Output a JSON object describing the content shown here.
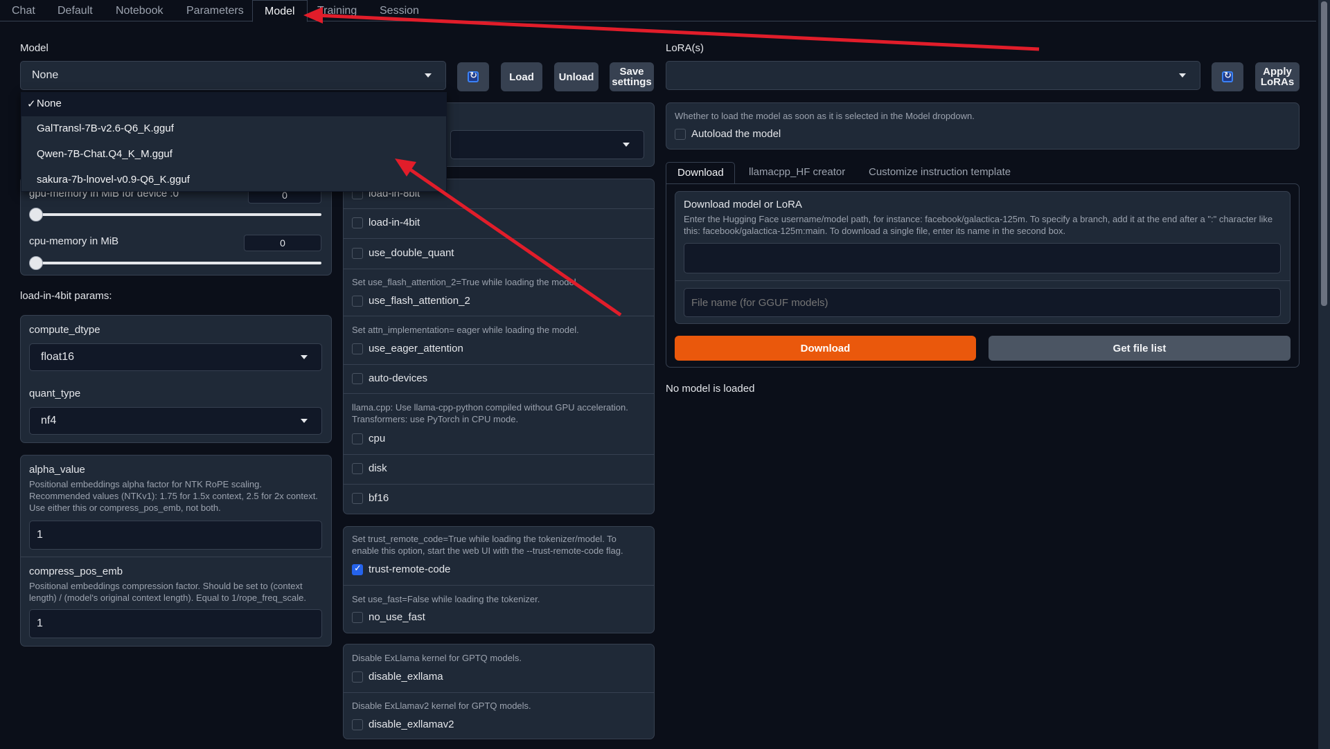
{
  "tabs": [
    "Chat",
    "Default",
    "Notebook",
    "Parameters",
    "Model",
    "Training",
    "Session"
  ],
  "active_tab": "Model",
  "model": {
    "label": "Model",
    "selected": "None",
    "options": [
      "None",
      "GalTransl-7B-v2.6-Q6_K.gguf",
      "Qwen-7B-Chat.Q4_K_M.gguf",
      "sakura-7b-lnovel-v0.9-Q6_K.gguf"
    ],
    "load_button": "Load",
    "unload_button": "Unload",
    "save_settings_button": "Save settings"
  },
  "memory": {
    "gpu_label": "gpu-memory in MiB for device :0",
    "gpu_value": "0",
    "cpu_label": "cpu-memory in MiB",
    "cpu_value": "0"
  },
  "load4bit": {
    "heading": "load-in-4bit params:",
    "compute_dtype_label": "compute_dtype",
    "compute_dtype_value": "float16",
    "quant_type_label": "quant_type",
    "quant_type_value": "nf4"
  },
  "alpha": {
    "label": "alpha_value",
    "info": "Positional embeddings alpha factor for NTK RoPE scaling. Recommended values (NTKv1): 1.75 for 1.5x context, 2.5 for 2x context. Use either this or compress_pos_emb, not both.",
    "value": "1"
  },
  "compress": {
    "label": "compress_pos_emb",
    "info": "Positional embeddings compression factor. Should be set to (context length) / (model's original context length). Equal to 1/rope_freq_scale.",
    "value": "1"
  },
  "checkboxes": {
    "load_in_8bit": "load-in-8bit",
    "load_in_4bit": "load-in-4bit",
    "use_double_quant": "use_double_quant",
    "flash_info": "Set use_flash_attention_2=True while loading the model.",
    "use_flash_attention_2": "use_flash_attention_2",
    "eager_info": "Set attn_implementation= eager while loading the model.",
    "use_eager_attention": "use_eager_attention",
    "auto_devices": "auto-devices",
    "cpu_info": "llama.cpp: Use llama-cpp-python compiled without GPU acceleration. Transformers: use PyTorch in CPU mode.",
    "cpu": "cpu",
    "disk": "disk",
    "bf16": "bf16",
    "trust_info": "Set trust_remote_code=True while loading the tokenizer/model. To enable this option, start the web UI with the --trust-remote-code flag.",
    "trust_remote_code": "trust-remote-code",
    "fast_info": "Set use_fast=False while loading the tokenizer.",
    "no_use_fast": "no_use_fast",
    "exllama_info": "Disable ExLlama kernel for GPTQ models.",
    "disable_exllama": "disable_exllama",
    "exllamav2_info": "Disable ExLlamav2 kernel for GPTQ models.",
    "disable_exllamav2": "disable_exllamav2"
  },
  "lora": {
    "label": "LoRA(s)",
    "apply_button": "Apply LoRAs"
  },
  "autoload": {
    "info": "Whether to load the model as soon as it is selected in the Model dropdown.",
    "label": "Autoload the model"
  },
  "download_tabs": [
    "Download",
    "llamacpp_HF creator",
    "Customize instruction template"
  ],
  "download": {
    "title": "Download model or LoRA",
    "info": "Enter the Hugging Face username/model path, for instance: facebook/galactica-125m. To specify a branch, add it at the end after a \":\" character like this: facebook/galactica-125m:main. To download a single file, enter its name in the second box.",
    "filename_placeholder": "File name (for GGUF models)",
    "download_button": "Download",
    "file_list_button": "Get file list"
  },
  "status": "No model is loaded",
  "colors": {
    "background": "#0b0f19",
    "panel": "#1f2937",
    "accent_orange": "#ea580c",
    "checkbox_blue": "#2563eb",
    "annotation_red": "#e11d2a"
  }
}
